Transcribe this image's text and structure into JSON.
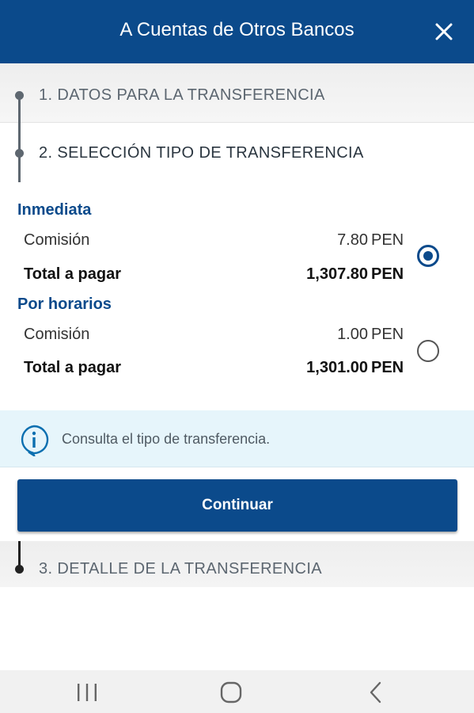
{
  "header": {
    "title": "A Cuentas de Otros Bancos",
    "close_icon": "close-icon"
  },
  "steps": [
    {
      "label": "1. DATOS PARA LA TRANSFERENCIA"
    },
    {
      "label": "2. SELECCIÓN TIPO DE TRANSFERENCIA"
    },
    {
      "label": "3. DETALLE DE LA TRANSFERENCIA"
    }
  ],
  "options": [
    {
      "title": "Inmediata",
      "commission_label": "Comisión",
      "commission_amount": "7.80",
      "commission_currency": "PEN",
      "total_label": "Total a pagar",
      "total_amount": "1,307.80",
      "total_currency": "PEN",
      "selected": true
    },
    {
      "title": "Por horarios",
      "commission_label": "Comisión",
      "commission_amount": "1.00",
      "commission_currency": "PEN",
      "total_label": "Total a pagar",
      "total_amount": "1,301.00",
      "total_currency": "PEN",
      "selected": false
    }
  ],
  "info": {
    "icon": "info-icon",
    "text": "Consulta el tipo de transferencia."
  },
  "continue_button": {
    "label": "Continuar"
  },
  "nav": {
    "recents_icon": "recents-icon",
    "home_icon": "home-icon",
    "back_icon": "back-icon"
  },
  "colors": {
    "primary": "#0b4a8b",
    "info_background": "#e6f5fb",
    "accordion_background": "#eeeeee"
  }
}
